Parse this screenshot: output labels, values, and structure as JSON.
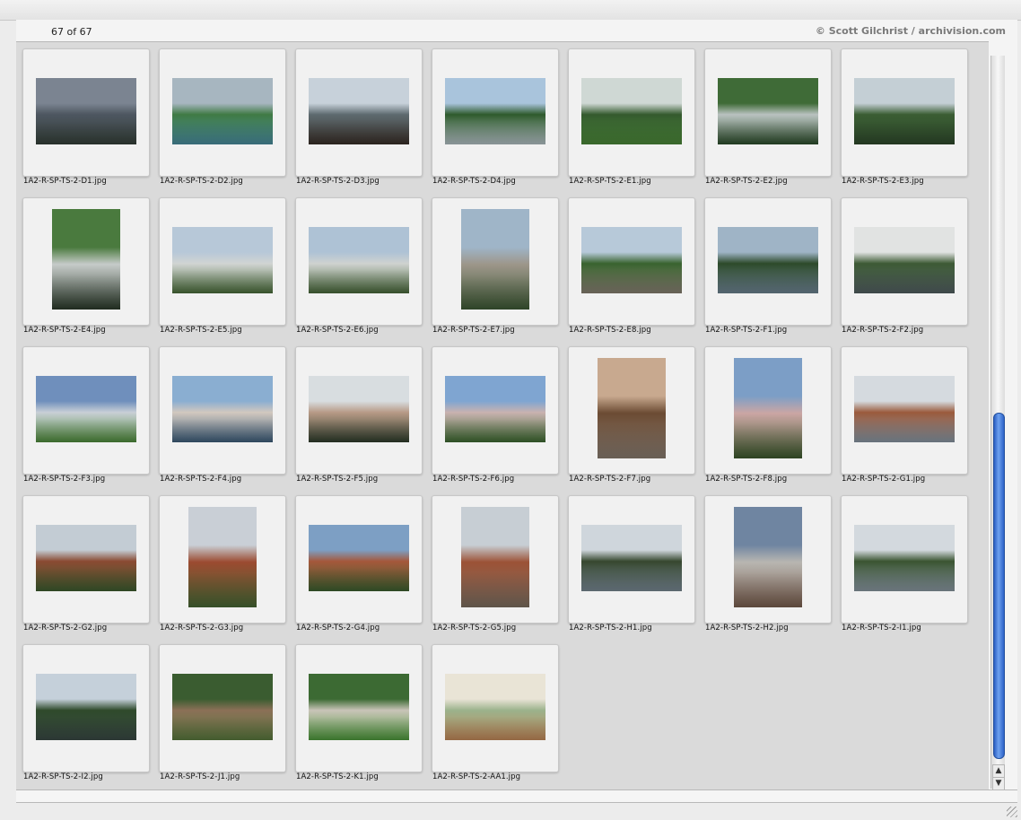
{
  "header": {
    "counter": "67 of 67",
    "credit": "© Scott Gilchrist / archivision.com"
  },
  "thumbnails": [
    {
      "file": "1A2-R-SP-TS-2-D1.jpg",
      "orient": "land",
      "colors": [
        "#7b8491",
        "#4d5660",
        "#36413a"
      ]
    },
    {
      "file": "1A2-R-SP-TS-2-D2.jpg",
      "orient": "land",
      "colors": [
        "#a7b6c0",
        "#3f7a44",
        "#4b8fa0"
      ]
    },
    {
      "file": "1A2-R-SP-TS-2-D3.jpg",
      "orient": "land",
      "colors": [
        "#c7d1da",
        "#5d6a6f",
        "#3a3029"
      ]
    },
    {
      "file": "1A2-R-SP-TS-2-D4.jpg",
      "orient": "land",
      "colors": [
        "#a9c4dc",
        "#2e5a2c",
        "#b6c4c8"
      ]
    },
    {
      "file": "1A2-R-SP-TS-2-E1.jpg",
      "orient": "land",
      "colors": [
        "#cfd8d4",
        "#345a2e",
        "#4c8a3a"
      ]
    },
    {
      "file": "1A2-R-SP-TS-2-E2.jpg",
      "orient": "land",
      "colors": [
        "#3f6b37",
        "#b9c2c0",
        "#2c4d2b"
      ]
    },
    {
      "file": "1A2-R-SP-TS-2-E3.jpg",
      "orient": "land",
      "colors": [
        "#c4cfd5",
        "#3a5d33",
        "#2f4a2c"
      ]
    },
    {
      "file": "1A2-R-SP-TS-2-E4.jpg",
      "orient": "port",
      "colors": [
        "#4a7a3e",
        "#c6cbc9",
        "#2b3a2a"
      ]
    },
    {
      "file": "1A2-R-SP-TS-2-E5.jpg",
      "orient": "land",
      "colors": [
        "#b7c8d8",
        "#d1d4d3",
        "#4b6e3b"
      ]
    },
    {
      "file": "1A2-R-SP-TS-2-E6.jpg",
      "orient": "land",
      "colors": [
        "#aec2d5",
        "#cfd2d0",
        "#49693a"
      ]
    },
    {
      "file": "1A2-R-SP-TS-2-E7.jpg",
      "orient": "port",
      "colors": [
        "#9fb5c8",
        "#9d968a",
        "#3e5a35"
      ]
    },
    {
      "file": "1A2-R-SP-TS-2-E8.jpg",
      "orient": "land",
      "colors": [
        "#b7c9d9",
        "#39632f",
        "#8a8274"
      ]
    },
    {
      "file": "1A2-R-SP-TS-2-F1.jpg",
      "orient": "land",
      "colors": [
        "#9fb4c6",
        "#2d4a2a",
        "#6f8594"
      ]
    },
    {
      "file": "1A2-R-SP-TS-2-F2.jpg",
      "orient": "land",
      "colors": [
        "#e1e3e2",
        "#3d5a35",
        "#546163"
      ]
    },
    {
      "file": "1A2-R-SP-TS-2-F3.jpg",
      "orient": "land",
      "colors": [
        "#6f8fbc",
        "#c9cfd6",
        "#4f8d3c"
      ]
    },
    {
      "file": "1A2-R-SP-TS-2-F4.jpg",
      "orient": "land",
      "colors": [
        "#8aaed1",
        "#d2c8bf",
        "#3e5f7c"
      ]
    },
    {
      "file": "1A2-R-SP-TS-2-F5.jpg",
      "orient": "land",
      "colors": [
        "#d8dde0",
        "#b79a86",
        "#2f3d2c"
      ]
    },
    {
      "file": "1A2-R-SP-TS-2-F6.jpg",
      "orient": "land",
      "colors": [
        "#7fa5d1",
        "#c9b2b0",
        "#3d6a31"
      ]
    },
    {
      "file": "1A2-R-SP-TS-2-F7.jpg",
      "orient": "port",
      "colors": [
        "#c8a98f",
        "#6b4b33",
        "#8c7e72"
      ]
    },
    {
      "file": "1A2-R-SP-TS-2-F8.jpg",
      "orient": "port",
      "colors": [
        "#7c9ec6",
        "#cba6a4",
        "#3d5a2d"
      ]
    },
    {
      "file": "1A2-R-SP-TS-2-G1.jpg",
      "orient": "land",
      "colors": [
        "#d5dadf",
        "#9a5a3c",
        "#8a99a6"
      ]
    },
    {
      "file": "1A2-R-SP-TS-2-G2.jpg",
      "orient": "land",
      "colors": [
        "#c3ccd4",
        "#8a4a32",
        "#3e5e30"
      ]
    },
    {
      "file": "1A2-R-SP-TS-2-G3.jpg",
      "orient": "port",
      "colors": [
        "#c9cfd6",
        "#9b4a30",
        "#486a36"
      ]
    },
    {
      "file": "1A2-R-SP-TS-2-G4.jpg",
      "orient": "land",
      "colors": [
        "#7d9fc4",
        "#a5583b",
        "#3c6130"
      ]
    },
    {
      "file": "1A2-R-SP-TS-2-G5.jpg",
      "orient": "port",
      "colors": [
        "#c7ced4",
        "#9c5236",
        "#7e7062"
      ]
    },
    {
      "file": "1A2-R-SP-TS-2-H1.jpg",
      "orient": "land",
      "colors": [
        "#cfd6dc",
        "#36472f",
        "#7a8a95"
      ]
    },
    {
      "file": "1A2-R-SP-TS-2-H2.jpg",
      "orient": "port",
      "colors": [
        "#6f85a1",
        "#b8b6b1",
        "#7a5e4e"
      ]
    },
    {
      "file": "1A2-R-SP-TS-2-I1.jpg",
      "orient": "land",
      "colors": [
        "#d3d9de",
        "#3a5431",
        "#8c9aa4"
      ]
    },
    {
      "file": "1A2-R-SP-TS-2-I2.jpg",
      "orient": "land",
      "colors": [
        "#c5d0da",
        "#2f4a2b",
        "#3a4a45"
      ]
    },
    {
      "file": "1A2-R-SP-TS-2-J1.jpg",
      "orient": "land",
      "colors": [
        "#3a5c30",
        "#8b7057",
        "#5a7a3e"
      ]
    },
    {
      "file": "1A2-R-SP-TS-2-K1.jpg",
      "orient": "land",
      "colors": [
        "#3c6a33",
        "#c9c4b8",
        "#4e9a3c"
      ]
    },
    {
      "file": "1A2-R-SP-TS-2-AA1.jpg",
      "orient": "land",
      "colors": [
        "#e9e4d6",
        "#9bb28c",
        "#c58a5a"
      ]
    }
  ],
  "scrollbar": {
    "up_icon": "up-arrow-icon",
    "down_icon": "down-arrow-icon"
  }
}
